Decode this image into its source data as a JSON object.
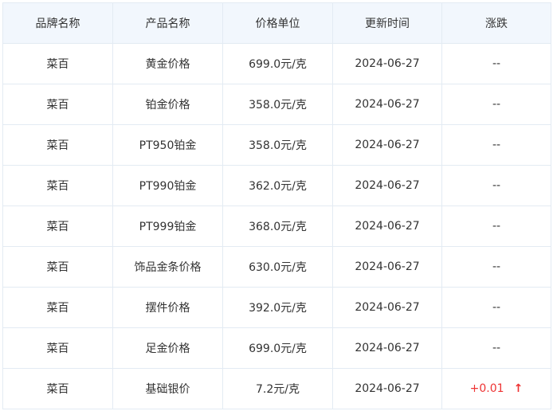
{
  "table": {
    "headers": [
      "品牌名称",
      "产品名称",
      "价格单位",
      "更新时间",
      "涨跌"
    ],
    "rows": [
      {
        "brand": "菜百",
        "product": "黄金价格",
        "price": "699.0元/克",
        "date": "2024-06-27",
        "change": "--",
        "trend": "flat"
      },
      {
        "brand": "菜百",
        "product": "铂金价格",
        "price": "358.0元/克",
        "date": "2024-06-27",
        "change": "--",
        "trend": "flat"
      },
      {
        "brand": "菜百",
        "product": "PT950铂金",
        "price": "358.0元/克",
        "date": "2024-06-27",
        "change": "--",
        "trend": "flat"
      },
      {
        "brand": "菜百",
        "product": "PT990铂金",
        "price": "362.0元/克",
        "date": "2024-06-27",
        "change": "--",
        "trend": "flat"
      },
      {
        "brand": "菜百",
        "product": "PT999铂金",
        "price": "368.0元/克",
        "date": "2024-06-27",
        "change": "--",
        "trend": "flat"
      },
      {
        "brand": "菜百",
        "product": "饰品金条价格",
        "price": "630.0元/克",
        "date": "2024-06-27",
        "change": "--",
        "trend": "flat"
      },
      {
        "brand": "菜百",
        "product": "摆件价格",
        "price": "392.0元/克",
        "date": "2024-06-27",
        "change": "--",
        "trend": "flat"
      },
      {
        "brand": "菜百",
        "product": "足金价格",
        "price": "699.0元/克",
        "date": "2024-06-27",
        "change": "--",
        "trend": "flat"
      },
      {
        "brand": "菜百",
        "product": "基础银价",
        "price": "7.2元/克",
        "date": "2024-06-27",
        "change": "+0.01",
        "trend": "up",
        "arrow": "↑"
      }
    ]
  },
  "colors": {
    "header_bg": "#f2f7fd",
    "border": "#e3ebf3",
    "up": "#ee3333"
  },
  "icons": {
    "up_arrow": "arrow-up-icon"
  }
}
